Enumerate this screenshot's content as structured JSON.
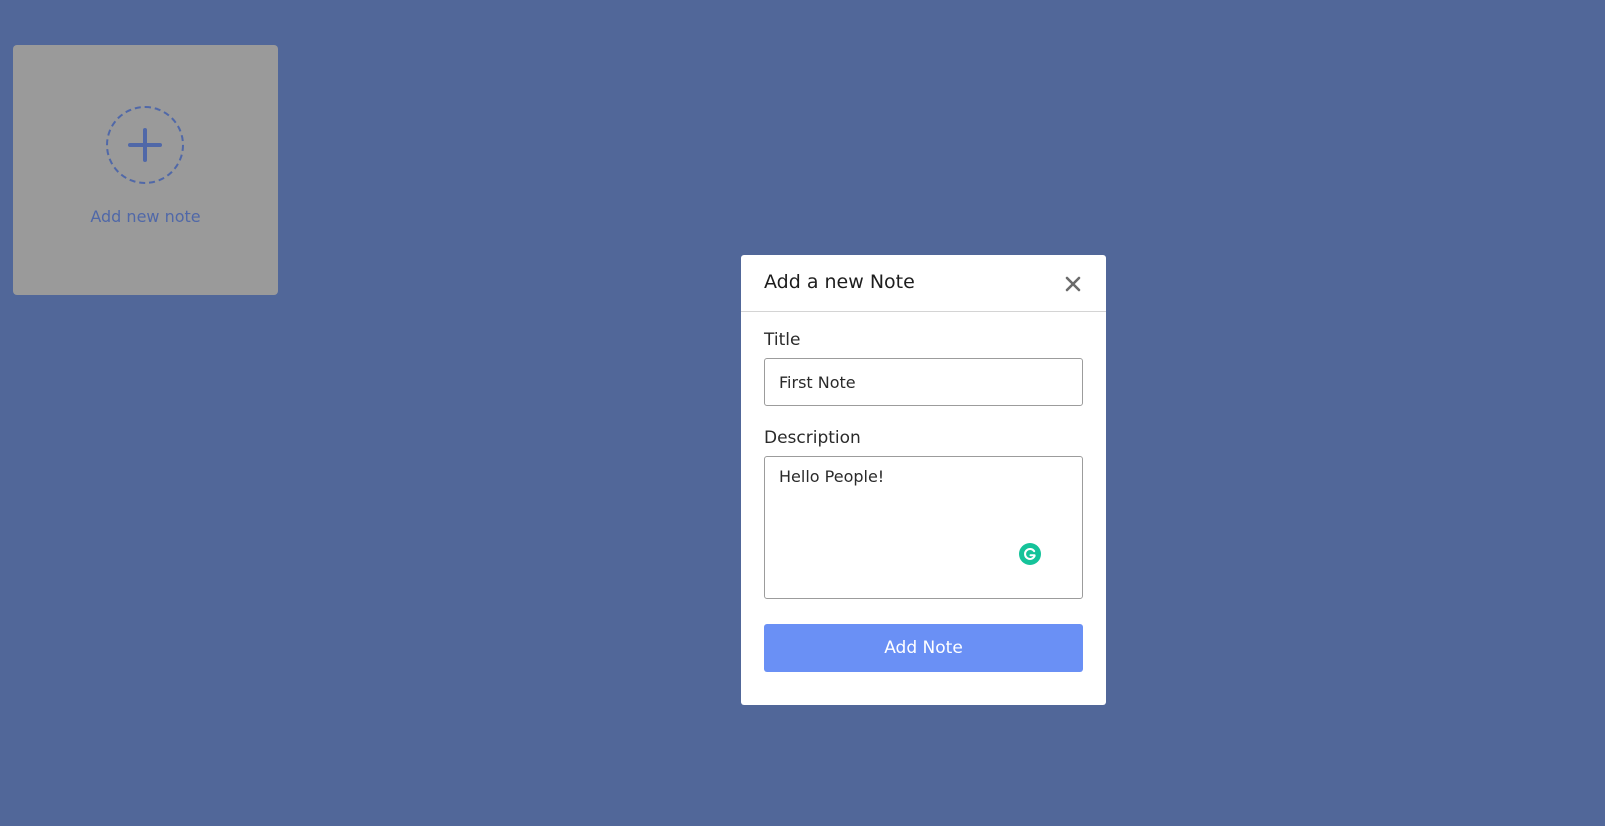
{
  "add_card": {
    "label": "Add new note",
    "icon": "plus-icon"
  },
  "modal": {
    "title": "Add a new Note",
    "close_icon": "close-icon",
    "title_field": {
      "label": "Title",
      "value": "First Note"
    },
    "description_field": {
      "label": "Description",
      "value": "Hello People!"
    },
    "submit_label": "Add Note",
    "grammarly_icon": "grammarly-icon"
  },
  "colors": {
    "background": "#516799",
    "card": "#9a9a9a",
    "accent": "#5068a8",
    "button": "#6a90f5",
    "grammarly": "#15c39a"
  }
}
